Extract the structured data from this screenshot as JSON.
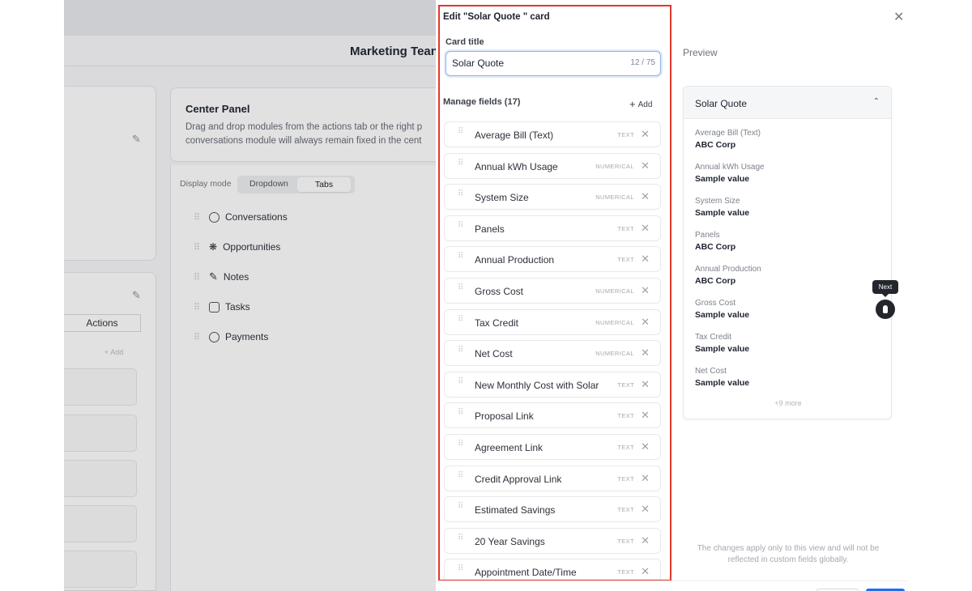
{
  "background": {
    "team_title": "Marketing Tean",
    "center_panel_title": "Center Panel",
    "center_panel_desc_line1": "Drag and drop modules from the actions tab or the right p",
    "center_panel_desc_line2": "conversations module will always remain fixed in the cent",
    "display_mode_label": "Display mode",
    "display_mode_options": [
      "Dropdown",
      "Tabs"
    ],
    "display_mode_selected": "Tabs",
    "actions_tab": "Actions",
    "add_small": "+ Add",
    "modules": [
      {
        "label": "Conversations",
        "icon": "chat-icon"
      },
      {
        "label": "Opportunities",
        "icon": "opportunities-icon"
      },
      {
        "label": "Notes",
        "icon": "pencil-icon"
      },
      {
        "label": "Tasks",
        "icon": "clipboard-icon"
      },
      {
        "label": "Payments",
        "icon": "dollar-circle-icon"
      }
    ]
  },
  "editor": {
    "heading": "Edit \"Solar Quote \" card",
    "card_title_label": "Card title",
    "card_title_value": "Solar Quote",
    "card_title_count": "12 / 75",
    "manage_fields_label": "Manage fields (17)",
    "add_label": "Add",
    "fields": [
      {
        "name": "Average Bill (Text)",
        "type": "TEXT"
      },
      {
        "name": "Annual kWh Usage",
        "type": "NUMERICAL"
      },
      {
        "name": "System Size",
        "type": "NUMERICAL"
      },
      {
        "name": "Panels",
        "type": "TEXT"
      },
      {
        "name": "Annual Production",
        "type": "TEXT"
      },
      {
        "name": "Gross Cost",
        "type": "NUMERICAL"
      },
      {
        "name": "Tax Credit",
        "type": "NUMERICAL"
      },
      {
        "name": "Net Cost",
        "type": "NUMERICAL"
      },
      {
        "name": "New Monthly Cost with Solar",
        "type": "TEXT"
      },
      {
        "name": "Proposal Link",
        "type": "TEXT"
      },
      {
        "name": "Agreement Link",
        "type": "TEXT"
      },
      {
        "name": "Credit Approval Link",
        "type": "TEXT"
      },
      {
        "name": "Estimated Savings",
        "type": "TEXT"
      },
      {
        "name": "20 Year Savings",
        "type": "TEXT"
      },
      {
        "name": "Appointment Date/Time",
        "type": "TEXT"
      }
    ]
  },
  "preview": {
    "label": "Preview",
    "card_title": "Solar Quote",
    "items": [
      {
        "label": "Average Bill (Text)",
        "value": "ABC Corp"
      },
      {
        "label": "Annual kWh Usage",
        "value": "Sample value"
      },
      {
        "label": "System Size",
        "value": "Sample value"
      },
      {
        "label": "Panels",
        "value": "ABC Corp"
      },
      {
        "label": "Annual Production",
        "value": "ABC Corp"
      },
      {
        "label": "Gross Cost",
        "value": "Sample value"
      },
      {
        "label": "Tax Credit",
        "value": "Sample value"
      },
      {
        "label": "Net Cost",
        "value": "Sample value"
      }
    ],
    "more": "+9 more",
    "note": "The changes apply only to this view and will not be reflected in custom fields globally.",
    "next_tooltip": "Next"
  },
  "colors": {
    "highlight_border": "#e0392d",
    "input_focus": "#8fb2e8",
    "primary_button": "#1f6feb"
  }
}
